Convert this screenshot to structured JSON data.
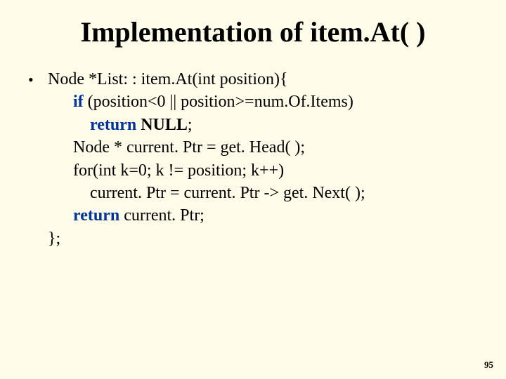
{
  "title": "Implementation of item.At( )",
  "bullet_glyph": "•",
  "code": {
    "decl": "Node *List: : item.At(int position){",
    "if_kw": "if",
    "if_cond": " (position<0 || position>=num.Of.Items)",
    "return_kw1": "return",
    "null_kw": " NULL",
    "semi1": ";",
    "ptr_decl": "Node * current. Ptr = get. Head( );",
    "for_line": "for(int k=0; k != position; k++)",
    "for_body": "current. Ptr = current. Ptr -> get. Next( );",
    "return_kw2": "return",
    "return_val": " current. Ptr;",
    "close": "};"
  },
  "page_number": "95"
}
